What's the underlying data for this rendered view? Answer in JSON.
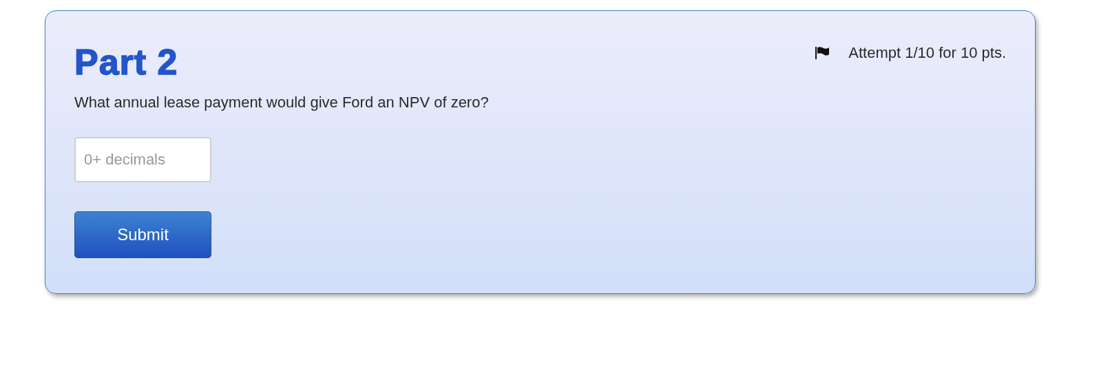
{
  "part": {
    "title": "Part 2",
    "attempt": "Attempt 1/10 for 10 pts.",
    "question": "What annual lease payment would give Ford an NPV of zero?",
    "answer": {
      "placeholder": "0+ decimals"
    },
    "submit": "Submit"
  }
}
